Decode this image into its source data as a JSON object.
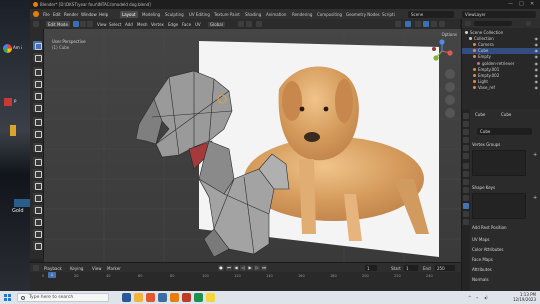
{
  "window": {
    "title": "Blender* [D:\\DKST\\year four\\INTACs\\modeld dog.blend]",
    "controls": [
      "—",
      "□",
      "✕"
    ]
  },
  "background": {
    "left_text_1": "Am i",
    "left_text_2": "P",
    "left_text_3": "Gold"
  },
  "menubar": {
    "items": [
      "File",
      "Edit",
      "Render",
      "Window",
      "Help"
    ],
    "workspaces": [
      "Layout",
      "Modeling",
      "Sculpting",
      "UV Editing",
      "Texture Paint",
      "Shading",
      "Animation",
      "Rendering",
      "Compositing",
      "Geometry Nodes",
      "Scripti"
    ],
    "active_workspace": "Layout",
    "scene_label": "Scene",
    "view_layer_label": "ViewLayer"
  },
  "tool_header": {
    "mode": "Edit Mode",
    "menus": [
      "View",
      "Select",
      "Add",
      "Mesh",
      "Vertex",
      "Edge",
      "Face",
      "UV"
    ],
    "transform": "Global"
  },
  "viewport": {
    "title": "User Perspective",
    "subtitle": "(1) Cube",
    "options_label": "Options"
  },
  "timeline": {
    "menus": [
      "Playback",
      "Keying",
      "View",
      "Marker"
    ],
    "current_frame": "1",
    "start_label": "Start",
    "start_value": "1",
    "end_label": "End",
    "end_value": "250",
    "ticks": [
      "0",
      "20",
      "40",
      "60",
      "80",
      "100",
      "120",
      "140",
      "160",
      "180",
      "200",
      "220",
      "240"
    ]
  },
  "outliner": {
    "items": [
      {
        "label": "Scene Collection",
        "color": "#d0d0d0",
        "selected": false
      },
      {
        "label": "Collection",
        "color": "#d0d0d0",
        "selected": false
      },
      {
        "label": "Camera",
        "color": "#e28a3d",
        "selected": false
      },
      {
        "label": "Cube",
        "color": "#e28a3d",
        "selected": true
      },
      {
        "label": "Empty",
        "color": "#e28a3d",
        "selected": false
      },
      {
        "label": "golden-retriever",
        "color": "#c96e9b",
        "selected": false
      },
      {
        "label": "Empty.001",
        "color": "#e28a3d",
        "selected": false
      },
      {
        "label": "Empty.002",
        "color": "#e28a3d",
        "selected": false
      },
      {
        "label": "Light",
        "color": "#e28a3d",
        "selected": false
      },
      {
        "label": "Vase_ref",
        "color": "#e28a3d",
        "selected": false
      }
    ]
  },
  "properties": {
    "header_object": "Cube",
    "header_data": "Cube",
    "name_field": "Cube",
    "vertex_groups": "Vertex Groups",
    "shape_keys": "Shape Keys",
    "sections": [
      "Add Rest Position",
      "UV Maps",
      "Color Attributes",
      "Face Maps",
      "Attributes",
      "Normals"
    ]
  },
  "taskbar": {
    "search_placeholder": "Type here to search",
    "time": "1:13 PM",
    "date": "12/19/2023",
    "app_colors": [
      "#2b5797",
      "#f0b43c",
      "#e2572e",
      "#3a6ea5",
      "#e87d0d",
      "#c0392b",
      "#1d8f4e",
      "#f5d43c"
    ]
  },
  "colors": {
    "accent": "#4772b3",
    "blender_orange": "#e87d0d",
    "viewport_bg": "#3d3d3d"
  }
}
